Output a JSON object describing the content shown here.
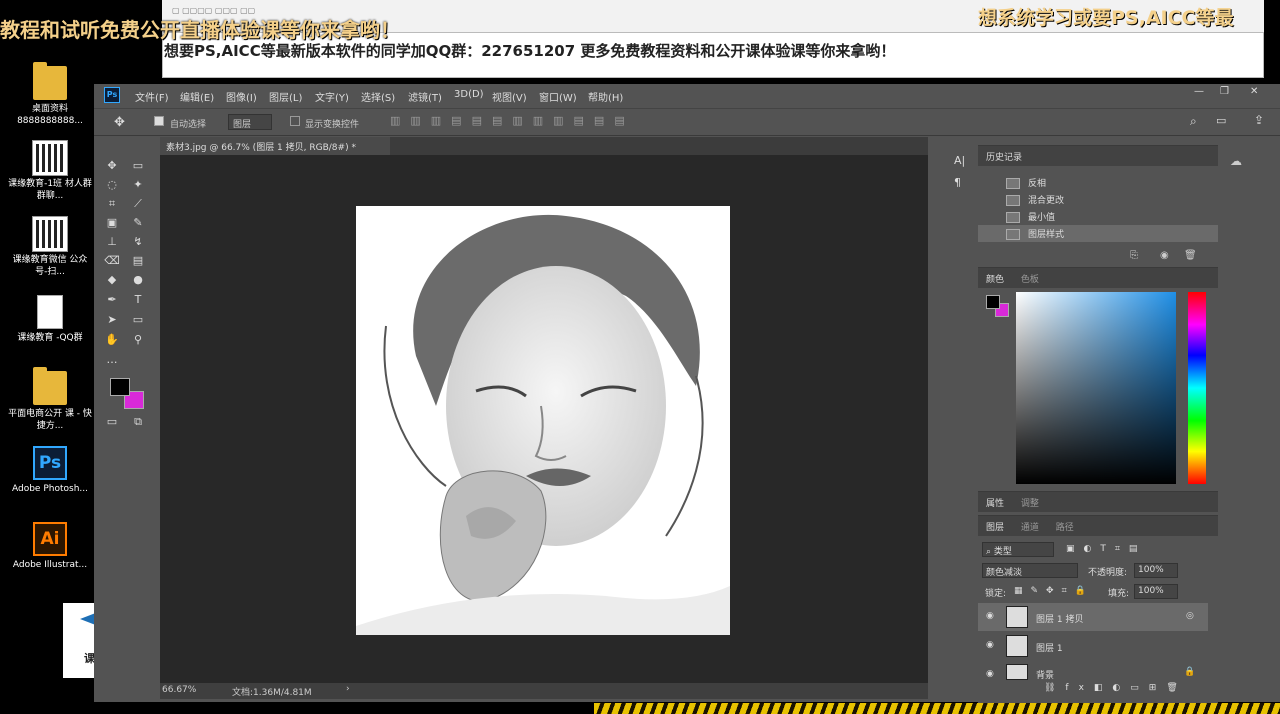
{
  "banners": {
    "left": "教程和试听免费公开直播体验课等你来拿哟！",
    "right": "想系统学习或要PS,AICC等最",
    "qq": "想要PS,AICC等最新版本软件的同学加QQ群：227651207 更多免费教程资料和公开课体验课等你来拿哟！"
  },
  "desktop": [
    {
      "label": "桌面资料 8888888888...",
      "icon": "folder-icon"
    },
    {
      "label": "课缘教育-1班 材人群群聊...",
      "icon": "qr-icon"
    },
    {
      "label": "课缘教育微信 公众号-扫...",
      "icon": "qr-icon"
    },
    {
      "label": "课缘教育 -QQ群",
      "icon": "document-icon"
    },
    {
      "label": "平面电商公开 课 - 快捷方...",
      "icon": "folder-icon"
    },
    {
      "label": "Adobe Photosh...",
      "icon": "ps-icon"
    },
    {
      "label": "Adobe Illustrat...",
      "icon": "ai-icon"
    }
  ],
  "logo": {
    "text": "课缘教育"
  },
  "ps": {
    "app_icon": "Ps",
    "menus": [
      "文件(F)",
      "编辑(E)",
      "图像(I)",
      "图层(L)",
      "文字(Y)",
      "选择(S)",
      "滤镜(T)",
      "3D(D)",
      "视图(V)",
      "窗口(W)",
      "帮助(H)"
    ],
    "options": {
      "auto_select": "自动选择",
      "layer_dropdown": "图层",
      "show_transform": "显示变换控件"
    },
    "tab": "素材3.jpg @ 66.7% (图层 1 拷贝, RGB/8#) *",
    "status": {
      "zoom": "66.67%",
      "doc": "文档:1.36M/4.81M"
    },
    "history": {
      "title": "历史记录",
      "items": [
        "反相",
        "混合更改",
        "最小值",
        "图层样式"
      ]
    },
    "color": {
      "tab1": "颜色",
      "tab2": "色板",
      "fg": "#000000",
      "bg": "#d929d9"
    },
    "props": {
      "tab1": "属性",
      "tab2": "调整"
    },
    "layers": {
      "tab1": "图层",
      "tab2": "通道",
      "tab3": "路径",
      "filter": "类型",
      "blend": "颜色减淡",
      "opacity_label": "不透明度:",
      "opacity": "100%",
      "lock_label": "锁定:",
      "fill_label": "填充:",
      "fill": "100%",
      "items": [
        "图层 1 拷贝",
        "图层 1",
        "背景"
      ]
    }
  }
}
